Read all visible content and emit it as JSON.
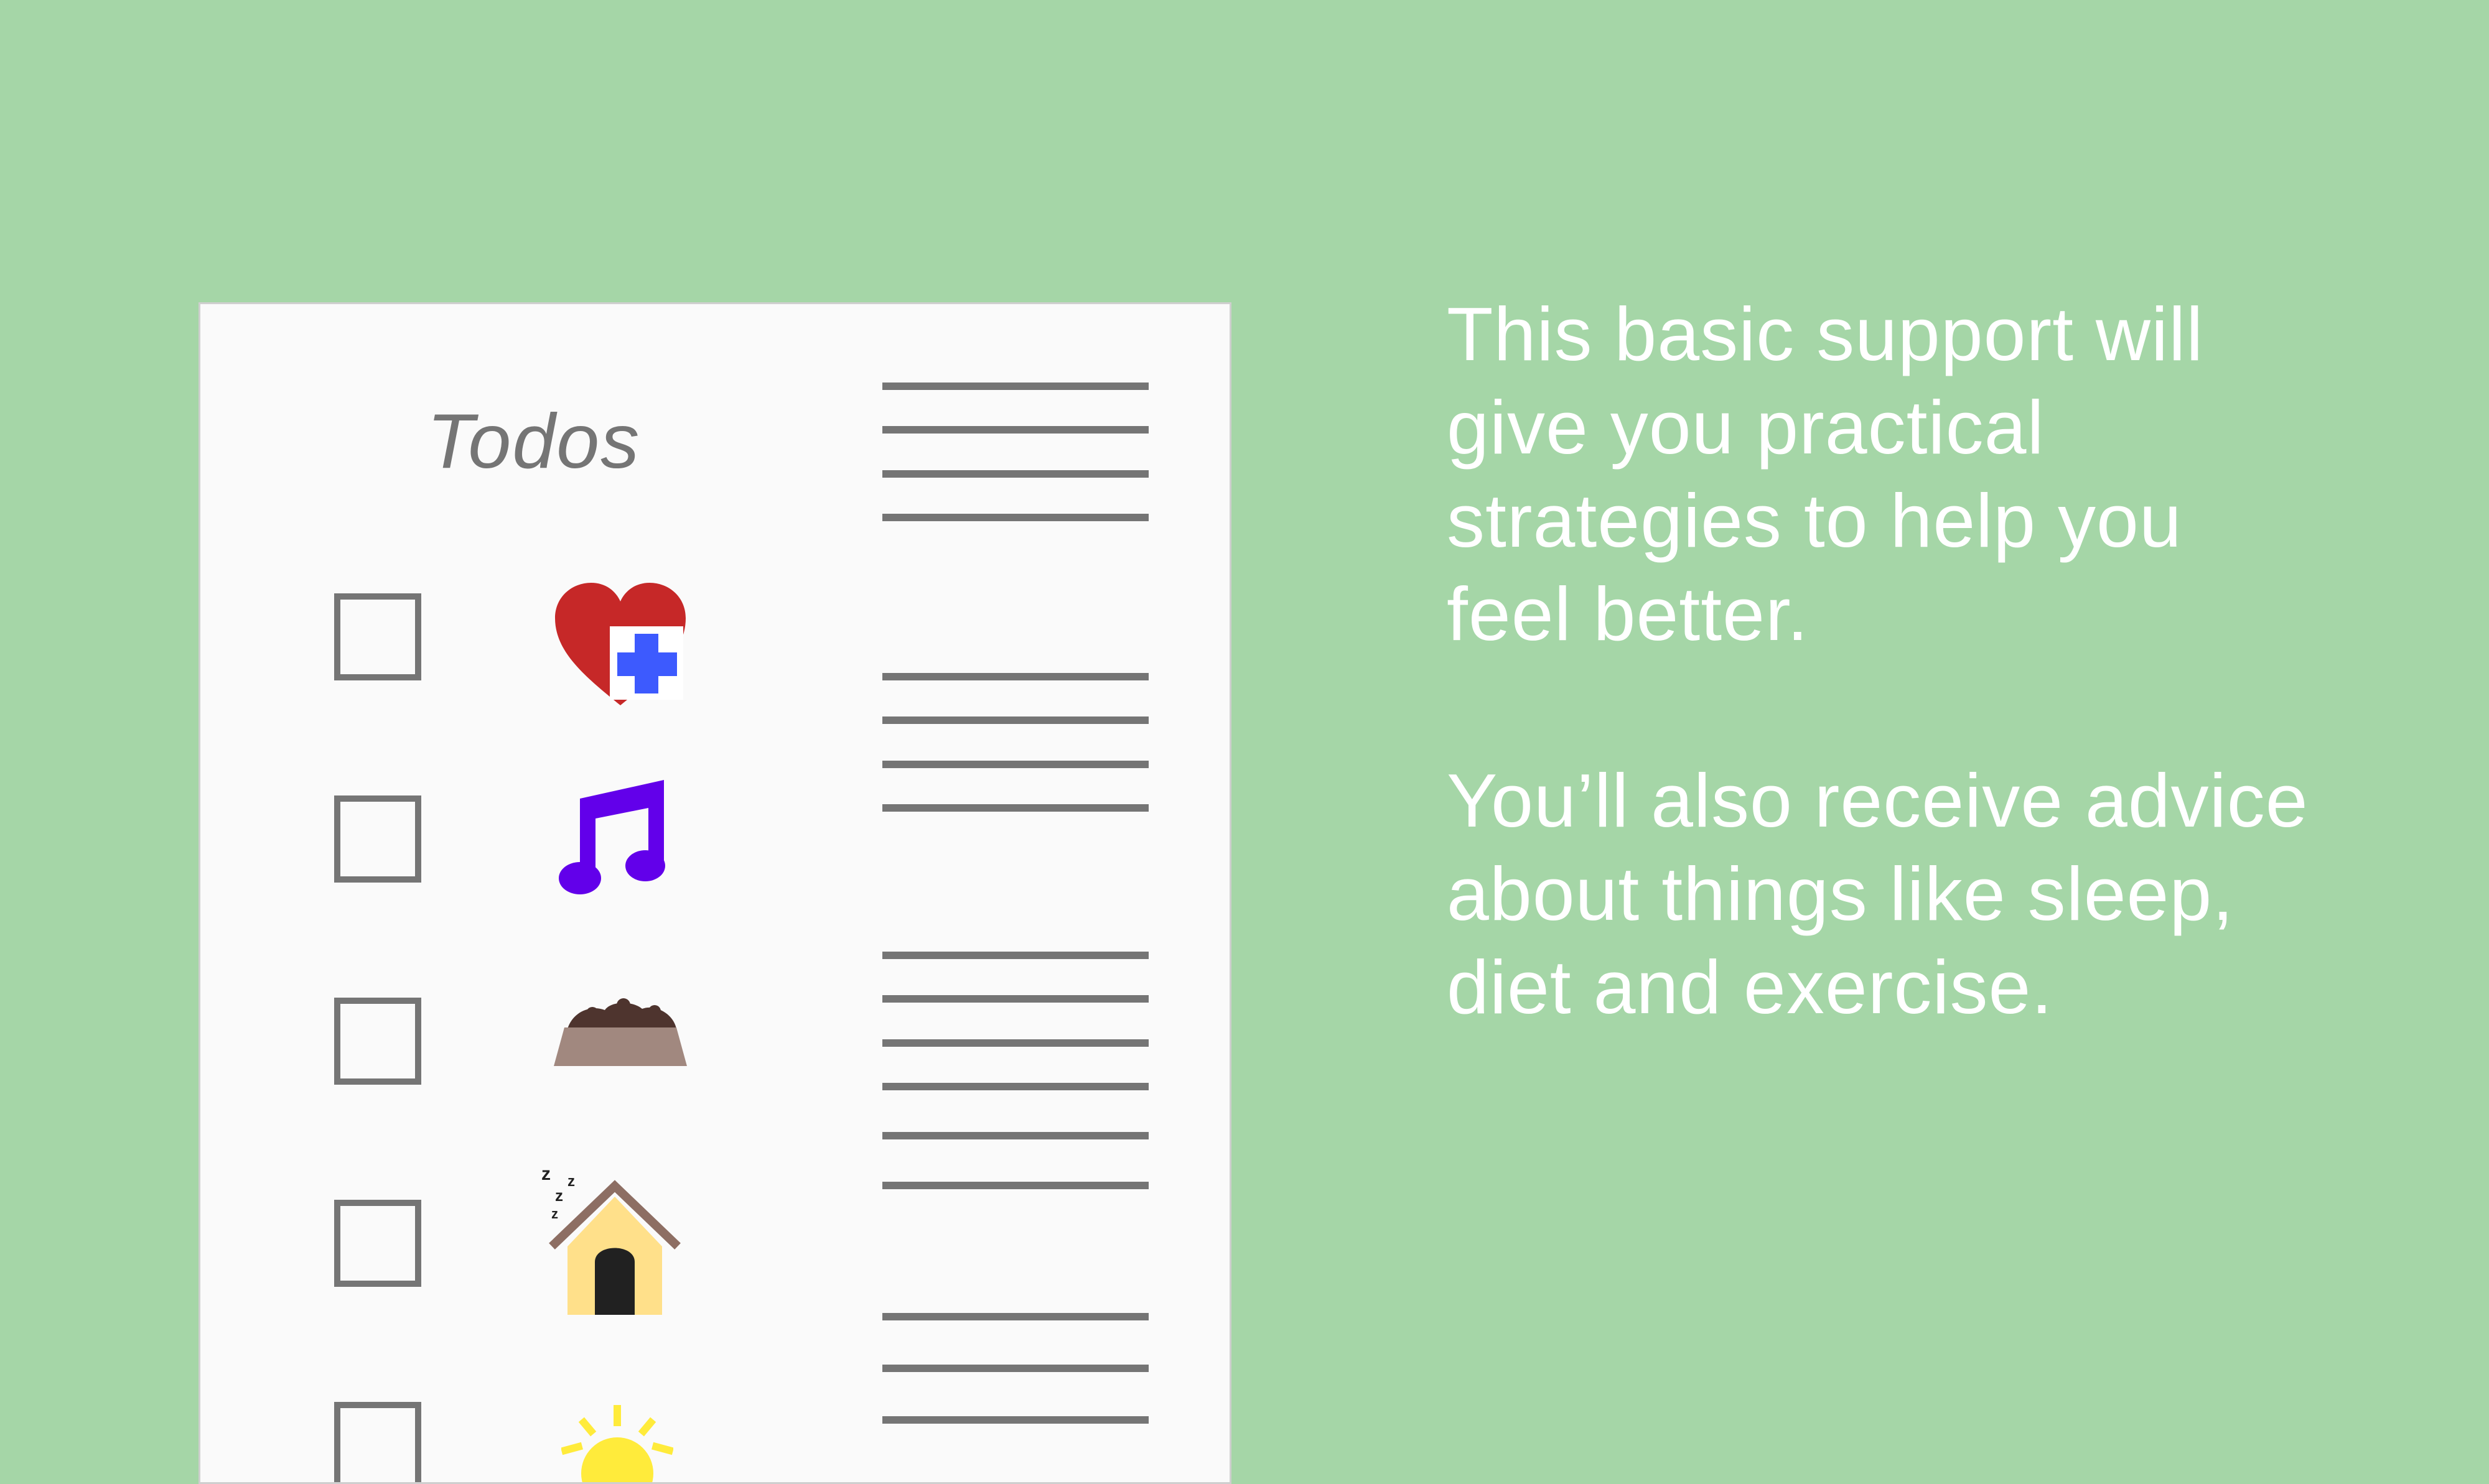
{
  "paper": {
    "title": "Todos",
    "items": [
      {
        "icon": "heart-health-icon"
      },
      {
        "icon": "music-note-icon"
      },
      {
        "icon": "food-bowl-icon"
      },
      {
        "icon": "sleeping-house-icon"
      },
      {
        "icon": "sun-icon"
      }
    ]
  },
  "copy": {
    "paragraph_1": "This basic support will give you practical strategies to help you feel better.",
    "paragraph_2": "You’ll also receive advice about things like sleep, diet and exercise."
  },
  "colors": {
    "background": "#a5d6a7",
    "paper": "#fafafa",
    "line": "#757575",
    "heart": "#c62828",
    "cross": "#3d5afe",
    "music": "#6200ea",
    "bowl": "#a1887f",
    "food": "#4e342e",
    "house_wall": "#ffe08a",
    "house_roof": "#8d6e63",
    "door": "#212121",
    "sun": "#ffeb3b"
  }
}
